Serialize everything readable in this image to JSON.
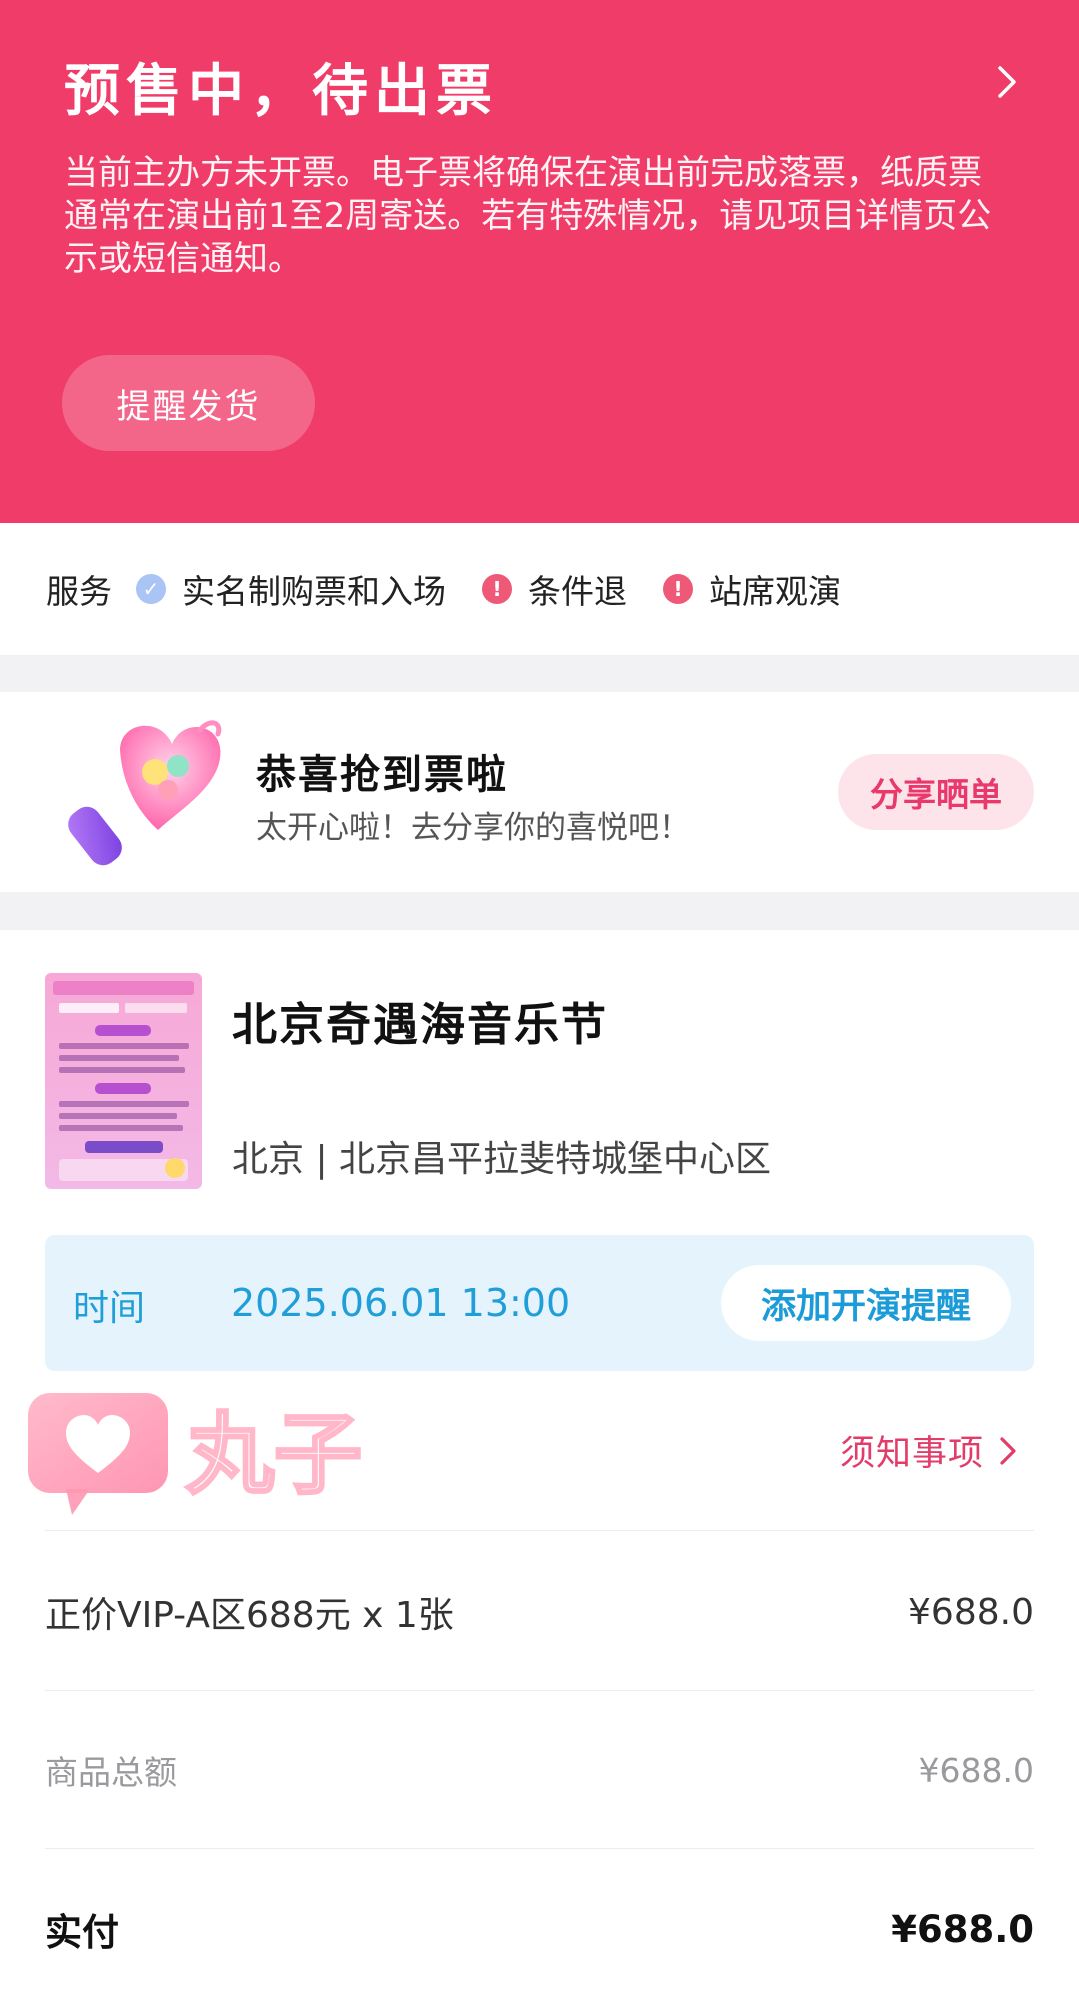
{
  "status": {
    "title": "预售中，待出票",
    "description": "当前主办方未开票。电子票将确保在演出前完成落票，纸质票通常在演出前1至2周寄送。若有特殊情况，请见项目详情页公示或短信通知。",
    "remind_button": "提醒发货"
  },
  "service": {
    "label": "服务",
    "items": [
      {
        "label": "实名制购票和入场",
        "icon": "check-circle-icon"
      },
      {
        "label": "条件退",
        "icon": "exclamation-circle-icon"
      },
      {
        "label": "站席观演",
        "icon": "exclamation-circle-icon"
      }
    ]
  },
  "congrats": {
    "title": "恭喜抢到票啦",
    "subtitle": "太开心啦！去分享你的喜悦吧！",
    "share_button": "分享晒单"
  },
  "event": {
    "title": "北京奇遇海音乐节",
    "venue": "北京 | 北京昌平拉斐特城堡中心区",
    "time_label": "时间",
    "time_value": "2025.06.01 13:00",
    "reminder_button": "添加开演提醒"
  },
  "watermark": {
    "text": "丸子"
  },
  "notice_link": "须知事项",
  "order": {
    "ticket_line": {
      "label": "正价VIP-A区688元 x 1张",
      "amount": "¥688.0"
    },
    "subtotal": {
      "label": "商品总额",
      "amount": "¥688.0"
    },
    "paid": {
      "label": "实付",
      "amount": "¥688.0"
    }
  },
  "colors": {
    "header_bg": "#f03c69",
    "accent_blue": "#1f9ed8",
    "accent_pink": "#e23c6a",
    "time_box_bg": "#e5f4fc"
  }
}
